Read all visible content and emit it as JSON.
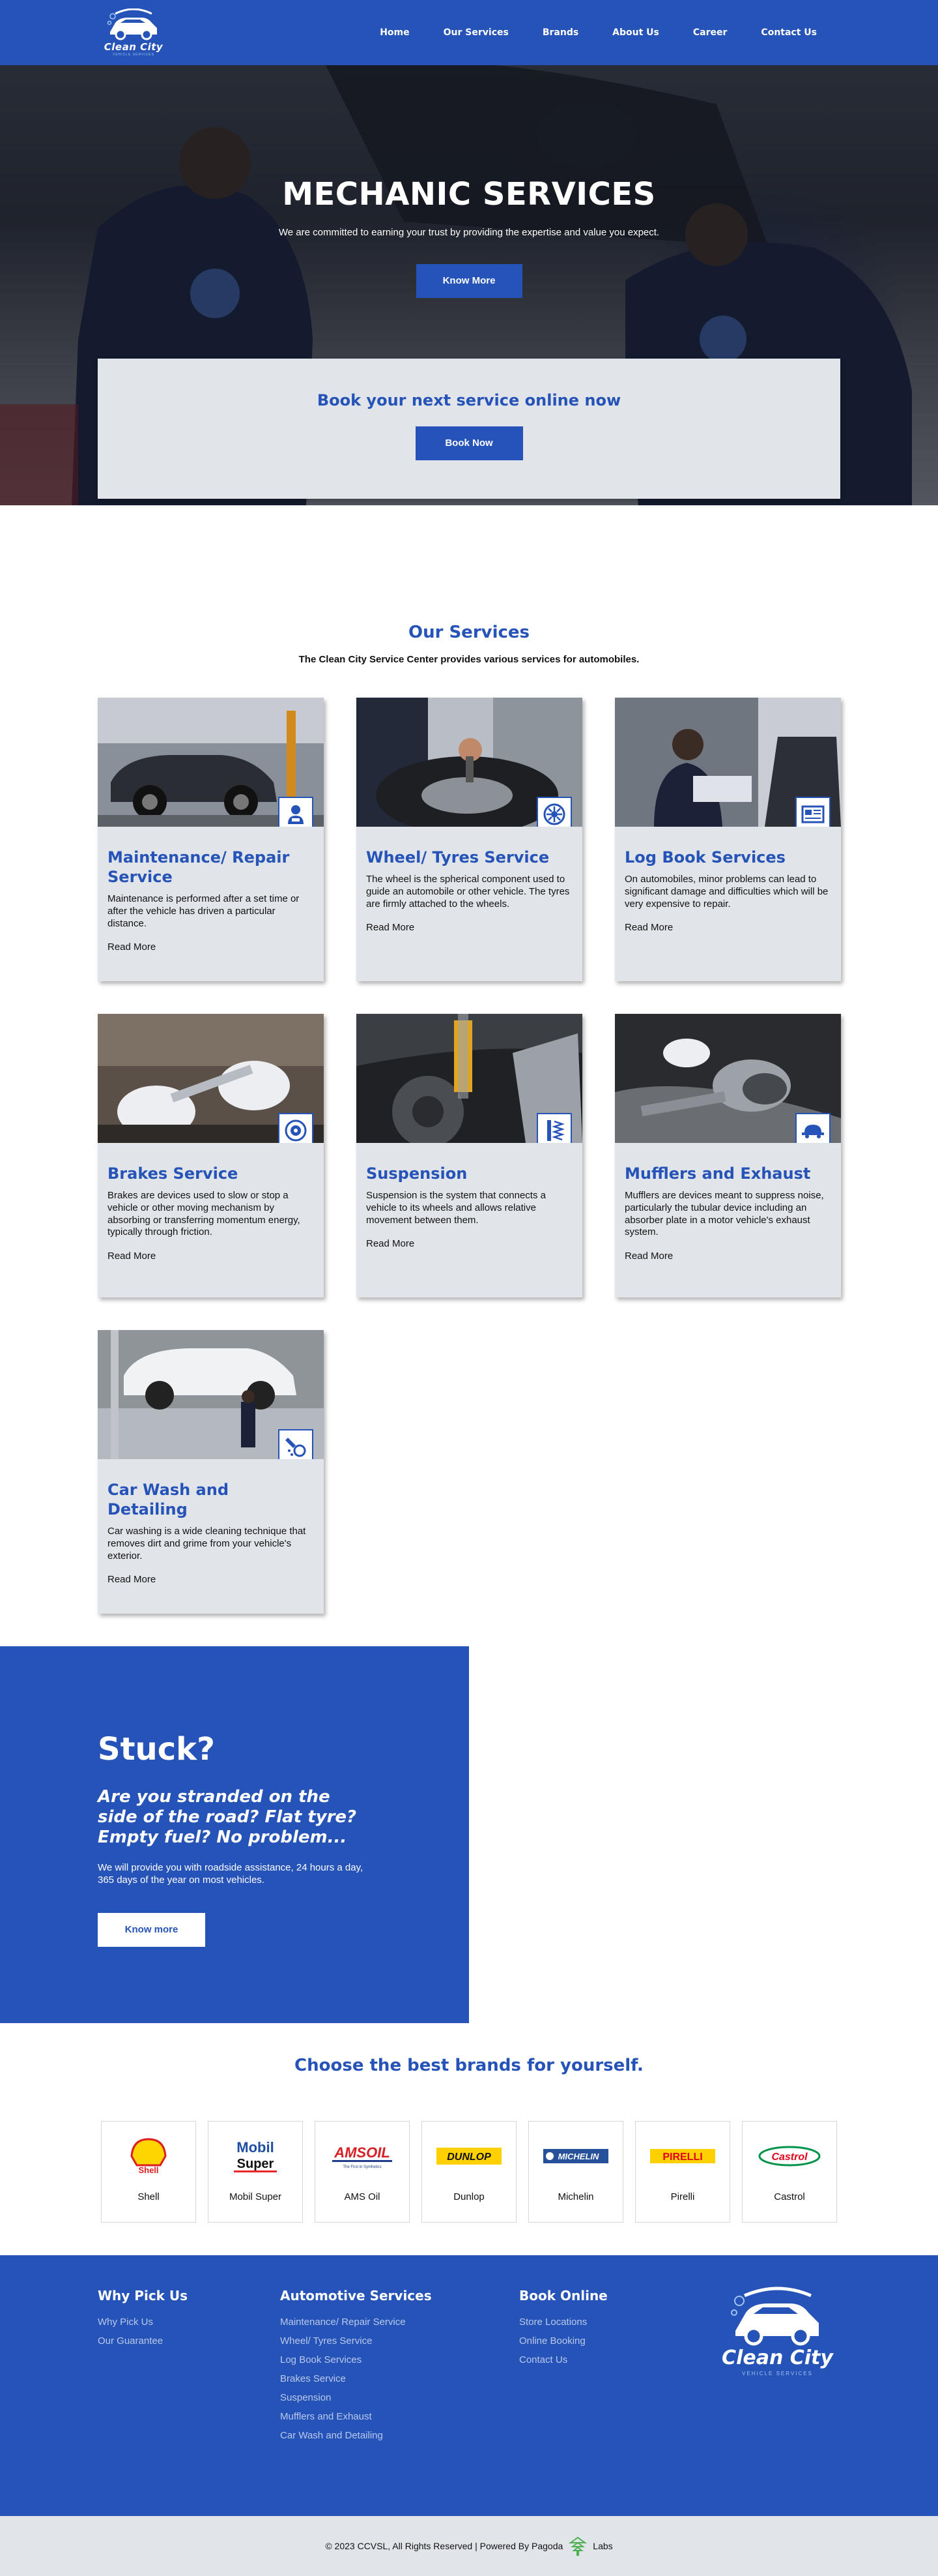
{
  "brand": {
    "name": "Clean City",
    "tagline": "VEHICLE SERVICES"
  },
  "nav": {
    "items": [
      "Home",
      "Our Services",
      "Brands",
      "About Us",
      "Career",
      "Contact Us"
    ]
  },
  "hero": {
    "title": "MECHANIC SERVICES",
    "subtitle": "We are committed to earning your trust by providing the expertise and value you expect.",
    "button": "Know More"
  },
  "booking": {
    "title": "Book your next service online now",
    "button": "Book Now"
  },
  "services": {
    "title": "Our Services",
    "subtitle": "The Clean City Service Center provides various services for automobiles.",
    "read_more": "Read More",
    "items": [
      {
        "title": "Maintenance/ Repair Service",
        "text": "Maintenance is performed after a set time or after the vehicle has driven a particular distance.",
        "icon": "mechanic-icon"
      },
      {
        "title": "Wheel/ Tyres Service",
        "text": "The wheel is the spherical component used to guide an automobile or other vehicle. The tyres are firmly attached to the wheels.",
        "icon": "wheel-icon"
      },
      {
        "title": "Log Book Services",
        "text": "On automobiles, minor problems can lead to significant damage and difficulties which will be very expensive to repair.",
        "icon": "logbook-icon"
      },
      {
        "title": "Brakes Service",
        "text": "Brakes are devices used to slow or stop a vehicle or other moving mechanism by absorbing or transferring momentum energy, typically through friction.",
        "icon": "brake-disc-icon"
      },
      {
        "title": "Suspension",
        "text": "Suspension is the system that connects a vehicle to its wheels and allows relative movement between them.",
        "icon": "suspension-icon"
      },
      {
        "title": "Mufflers and Exhaust",
        "text": "Mufflers are devices meant to suppress noise, particularly the tubular device including an absorber plate in a motor vehicle's exhaust system.",
        "icon": "exhaust-icon"
      },
      {
        "title": "Car Wash and Detailing",
        "text": "Car washing is a wide cleaning technique that removes dirt and grime from your vehicle's exterior.",
        "icon": "car-wash-icon"
      }
    ]
  },
  "stuck": {
    "title": "Stuck?",
    "question": "Are you stranded on the side of the road? Flat tyre? Empty fuel? No problem...",
    "text": "We will provide you with roadside assistance, 24 hours a day, 365 days of the year on most vehicles.",
    "button": "Know more"
  },
  "brands": {
    "title": "Choose the best brands for yourself.",
    "items": [
      {
        "name": "Shell",
        "logo": "Shell"
      },
      {
        "name": "Mobil Super",
        "logo": "Mobil"
      },
      {
        "name": "AMS Oil",
        "logo": "AMSOIL"
      },
      {
        "name": "Dunlop",
        "logo": "DUNLOP"
      },
      {
        "name": "Michelin",
        "logo": "MICHELIN"
      },
      {
        "name": "Pirelli",
        "logo": "PIRELLI"
      },
      {
        "name": "Castrol",
        "logo": "Castrol"
      }
    ]
  },
  "footer": {
    "col1": {
      "title": "Why Pick Us",
      "links": [
        "Why Pick Us",
        "Our Guarantee"
      ]
    },
    "col2": {
      "title": "Automotive Services",
      "links": [
        "Maintenance/ Repair Service",
        "Wheel/ Tyres Service",
        "Log Book Services",
        "Brakes Service",
        "Suspension",
        "Mufflers and Exhaust",
        "Car Wash and Detailing"
      ]
    },
    "col3": {
      "title": "Book Online",
      "links": [
        "Store Locations",
        "Online Booking",
        "Contact Us"
      ]
    },
    "copyright": "© 2023 CCVSL, All Rights Reserved | Powered By Pagoda",
    "copyright_suffix": "Labs"
  },
  "colors": {
    "primary": "#2653b8",
    "card_bg": "#e1e5e9",
    "footer_link": "#b9c9ec"
  }
}
